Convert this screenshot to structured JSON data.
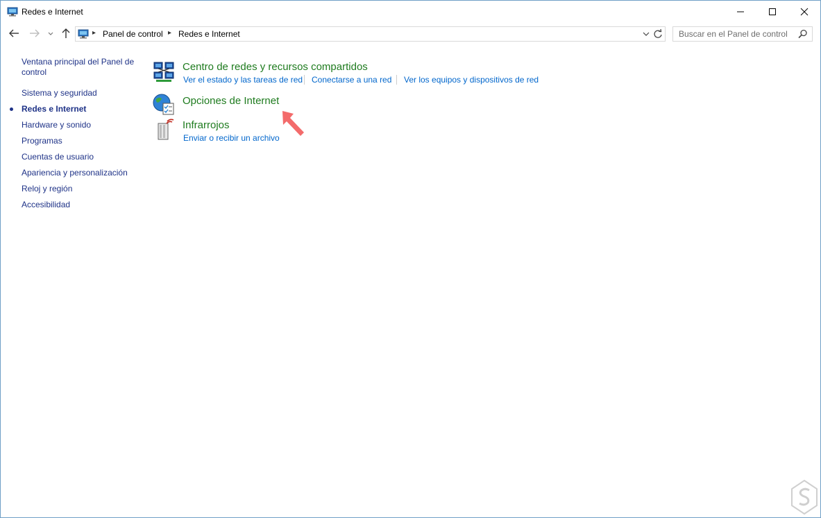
{
  "window": {
    "title": "Redes e Internet"
  },
  "address": {
    "crumbs": [
      "Panel de control",
      "Redes e Internet"
    ]
  },
  "search": {
    "placeholder": "Buscar en el Panel de control",
    "value": ""
  },
  "leftnav": {
    "items": [
      {
        "label": "Ventana principal del Panel de control",
        "current": false
      },
      {
        "label": "Sistema y seguridad",
        "current": false
      },
      {
        "label": "Redes e Internet",
        "current": true
      },
      {
        "label": "Hardware y sonido",
        "current": false
      },
      {
        "label": "Programas",
        "current": false
      },
      {
        "label": "Cuentas de usuario",
        "current": false
      },
      {
        "label": "Apariencia y personalización",
        "current": false
      },
      {
        "label": "Reloj y región",
        "current": false
      },
      {
        "label": "Accesibilidad",
        "current": false
      }
    ]
  },
  "categories": [
    {
      "title": "Centro de redes y recursos compartidos",
      "icon": "network-sharing-icon",
      "tasks": [
        "Ver el estado y las tareas de red",
        "Conectarse a una red",
        "Ver los equipos y dispositivos de red"
      ]
    },
    {
      "title": "Opciones de Internet",
      "icon": "internet-options-icon",
      "tasks": []
    },
    {
      "title": "Infrarrojos",
      "icon": "infrared-icon",
      "tasks": [
        "Enviar o recibir un archivo"
      ]
    }
  ],
  "colors": {
    "category_title": "#1e7b1e",
    "task_link": "#0066cc",
    "nav_link": "#1e3287",
    "annotation_arrow": "#f36b6b"
  }
}
